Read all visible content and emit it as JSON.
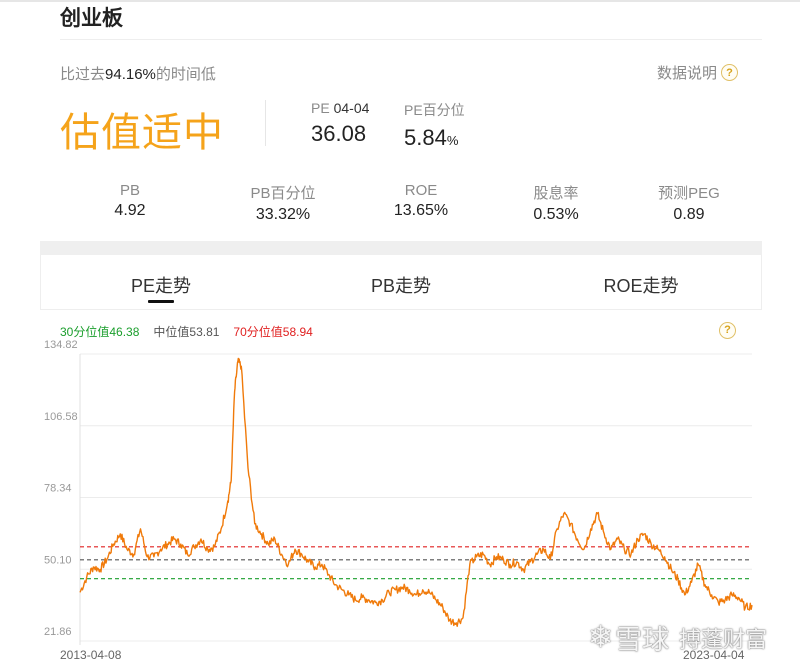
{
  "header": {
    "title": "创业板"
  },
  "summary": {
    "prefix": "比过去",
    "percent": "94.16%",
    "suffix": "的时间低",
    "explain_label": "数据说明",
    "verdict": "估值适中"
  },
  "pe": {
    "label": "PE",
    "date": "04-04",
    "value": "36.08"
  },
  "pe_pct": {
    "label": "PE百分位",
    "value": "5.84",
    "unit": "%"
  },
  "metrics": [
    {
      "label": "PB",
      "value": "4.92"
    },
    {
      "label": "PB百分位",
      "value": "33.32%"
    },
    {
      "label": "ROE",
      "value": "13.65%"
    },
    {
      "label": "股息率",
      "value": "0.53%"
    },
    {
      "label": "预测PEG",
      "value": "0.89"
    }
  ],
  "tabs": [
    {
      "label": "PE走势",
      "active": true
    },
    {
      "label": "PB走势",
      "active": false
    },
    {
      "label": "ROE走势",
      "active": false
    }
  ],
  "legend": [
    {
      "label": "30分位值46.38",
      "color": "#1a9e2c"
    },
    {
      "label": "中位值53.81",
      "color": "#555555"
    },
    {
      "label": "70分位值58.94",
      "color": "#e02020"
    }
  ],
  "help_icon": "question-icon",
  "watermark": {
    "logo": "❄",
    "text1": "雪球",
    "text2": "搏蓬财富"
  },
  "chart_data": {
    "type": "line",
    "ylim": [
      21.86,
      134.82
    ],
    "yticks": [
      "134.82",
      "106.58",
      "78.34",
      "50.10",
      "21.86"
    ],
    "x_start_label": "2013-04-08",
    "x_end_label": "2023-04-04",
    "reference_lines": [
      {
        "name": "30分位值",
        "value": 46.38,
        "color": "#1a9e2c"
      },
      {
        "name": "中位值",
        "value": 53.81,
        "color": "#555555"
      },
      {
        "name": "70分位值",
        "value": 58.94,
        "color": "#e02020"
      }
    ],
    "series": [
      {
        "color": "#f07a0a",
        "x": [
          0,
          0.01,
          0.02,
          0.03,
          0.04,
          0.05,
          0.06,
          0.07,
          0.08,
          0.09,
          0.1,
          0.11,
          0.12,
          0.13,
          0.14,
          0.15,
          0.16,
          0.17,
          0.18,
          0.19,
          0.2,
          0.21,
          0.22,
          0.225,
          0.23,
          0.235,
          0.24,
          0.25,
          0.26,
          0.27,
          0.28,
          0.29,
          0.3,
          0.31,
          0.32,
          0.33,
          0.34,
          0.35,
          0.36,
          0.37,
          0.38,
          0.39,
          0.4,
          0.41,
          0.42,
          0.43,
          0.44,
          0.45,
          0.46,
          0.47,
          0.48,
          0.49,
          0.5,
          0.51,
          0.52,
          0.53,
          0.54,
          0.55,
          0.56,
          0.57,
          0.58,
          0.59,
          0.6,
          0.61,
          0.62,
          0.63,
          0.64,
          0.65,
          0.66,
          0.67,
          0.68,
          0.69,
          0.7,
          0.71,
          0.72,
          0.73,
          0.74,
          0.75,
          0.76,
          0.77,
          0.78,
          0.79,
          0.8,
          0.81,
          0.82,
          0.83,
          0.84,
          0.85,
          0.86,
          0.87,
          0.88,
          0.89,
          0.9,
          0.91,
          0.92,
          0.93,
          0.94,
          0.95,
          0.96,
          0.97,
          0.98,
          0.99,
          1
        ],
        "values": [
          41,
          47,
          51,
          50,
          54,
          60,
          64,
          58,
          56,
          66,
          55,
          55,
          58,
          60,
          62,
          60,
          56,
          59,
          62,
          58,
          59,
          66,
          77,
          85,
          120,
          132,
          130,
          90,
          68,
          64,
          60,
          62,
          56,
          52,
          58,
          56,
          53,
          51,
          52,
          48,
          44,
          42,
          40,
          38,
          39,
          38,
          37,
          38,
          41,
          42,
          43,
          42,
          40,
          42,
          41,
          38,
          35,
          30,
          29,
          31,
          52,
          55,
          56,
          52,
          55,
          54,
          52,
          53,
          50,
          53,
          56,
          58,
          54,
          66,
          72,
          68,
          62,
          58,
          66,
          72,
          64,
          58,
          62,
          58,
          56,
          62,
          64,
          60,
          58,
          55,
          50,
          46,
          40,
          45,
          52,
          44,
          40,
          37,
          38,
          40,
          39,
          35,
          36
        ]
      }
    ]
  }
}
